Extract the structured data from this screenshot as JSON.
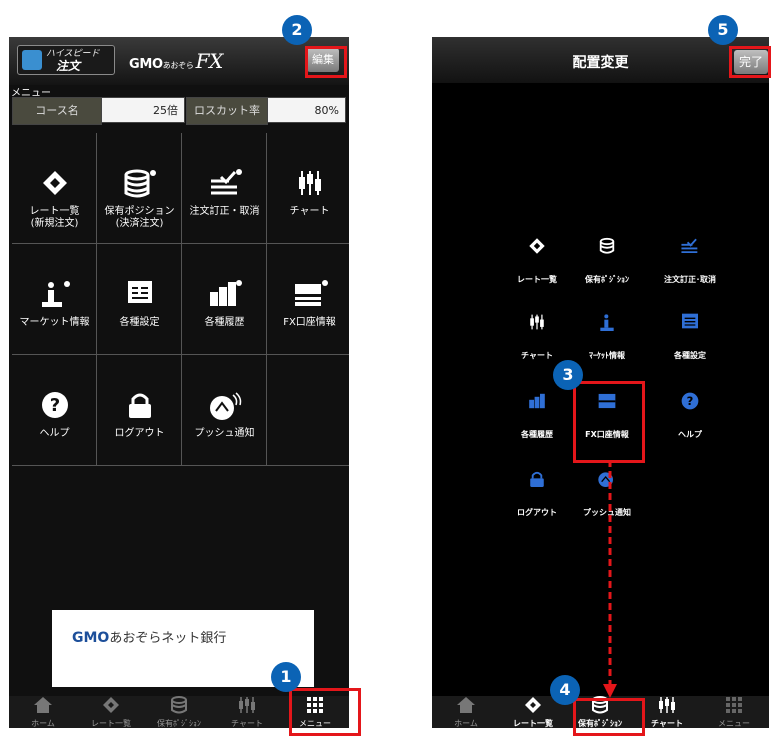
{
  "phone1": {
    "logo": {
      "line1": "ハイスピード",
      "line2": "注文"
    },
    "brand": {
      "gmo": "GMO",
      "aozora": "あおぞら",
      "fx": "FX"
    },
    "edit_label": "編集",
    "menu_label": "メニュー",
    "course": {
      "course_label": "コース名",
      "course_value": "25倍",
      "losscut_label": "ロスカット率",
      "losscut_value": "80%"
    },
    "grid": [
      {
        "line1": "レート一覧",
        "line2": "(新規注文)",
        "icon": "rate-list-icon"
      },
      {
        "line1": "保有ポジション",
        "line2": "(決済注文)",
        "icon": "position-icon"
      },
      {
        "line1": "注文訂正・取消",
        "line2": "",
        "icon": "order-edit-icon"
      },
      {
        "line1": "チャート",
        "line2": "",
        "icon": "chart-icon"
      },
      {
        "line1": "マーケット情報",
        "line2": "",
        "icon": "market-info-icon"
      },
      {
        "line1": "各種設定",
        "line2": "",
        "icon": "settings-icon"
      },
      {
        "line1": "各種履歴",
        "line2": "",
        "icon": "history-icon"
      },
      {
        "line1": "FX口座情報",
        "line2": "",
        "icon": "account-info-icon"
      },
      {
        "line1": "ヘルプ",
        "line2": "",
        "icon": "help-icon"
      },
      {
        "line1": "ログアウト",
        "line2": "",
        "icon": "logout-icon"
      },
      {
        "line1": "プッシュ通知",
        "line2": "",
        "icon": "push-notification-icon"
      }
    ],
    "banner": {
      "gmo": "GMO",
      "text": "あおぞらネット銀行"
    },
    "tabs": [
      "ホーム",
      "レート一覧",
      "保有ﾎﾟｼﾞｼｮﾝ",
      "チャート",
      "メニュー"
    ]
  },
  "phone2": {
    "title": "配置変更",
    "done_label": "完了",
    "icons": [
      {
        "label": "レート一覧",
        "icon": "rate-list-icon"
      },
      {
        "label": "保有ﾎﾟｼﾞｼｮﾝ",
        "icon": "position-icon"
      },
      {
        "label": "注文訂正･取消",
        "icon": "order-edit-icon"
      },
      {
        "label": "チャート",
        "icon": "chart-icon"
      },
      {
        "label": "ﾏｰｹｯﾄ情報",
        "icon": "market-info-icon"
      },
      {
        "label": "各種設定",
        "icon": "settings-icon"
      },
      {
        "label": "各種履歴",
        "icon": "history-icon"
      },
      {
        "label": "FX口座情報",
        "icon": "account-info-icon"
      },
      {
        "label": "ヘルプ",
        "icon": "help-icon"
      },
      {
        "label": "ログアウト",
        "icon": "logout-icon"
      },
      {
        "label": "プッシュ通知",
        "icon": "push-notification-icon"
      }
    ],
    "tabs": [
      "ホーム",
      "レート一覧",
      "保有ﾎﾟｼﾞｼｮﾝ",
      "チャート",
      "メニュー"
    ]
  },
  "annotations": {
    "step1": "1",
    "step2": "2",
    "step3": "3",
    "step4": "4",
    "step5": "5"
  },
  "colors": {
    "annotation_red": "#e4161a",
    "badge_blue": "#0b63b5",
    "icon_blue": "#2f6fd6"
  }
}
